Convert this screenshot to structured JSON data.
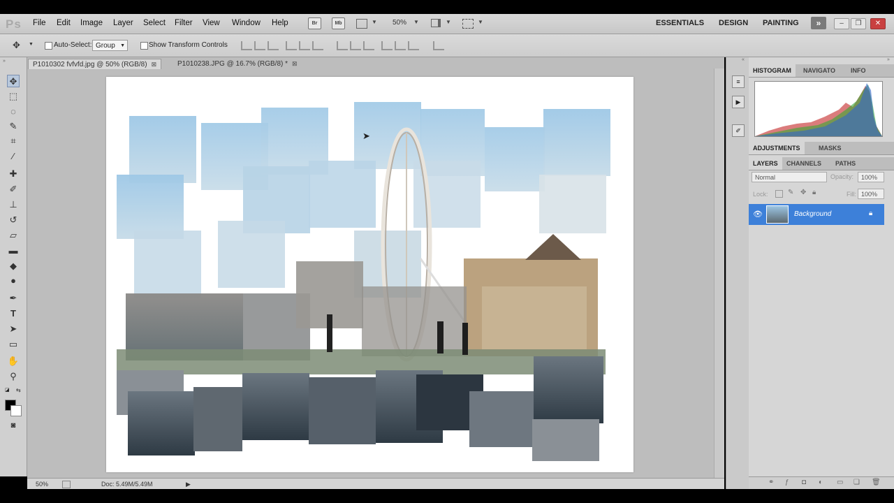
{
  "app": {
    "logo": "Ps"
  },
  "menu": [
    "File",
    "Edit",
    "Image",
    "Layer",
    "Select",
    "Filter",
    "View",
    "Window",
    "Help"
  ],
  "toolbar_icons": {
    "bridge": "Br",
    "minibridge": "Mb"
  },
  "zoom_top": "50%",
  "workspaces": [
    "ESSENTIALS",
    "DESIGN",
    "PAINTING"
  ],
  "workspace_more": "»",
  "window_controls": {
    "minimize": "–",
    "restore": "❐",
    "close": "✕"
  },
  "options": {
    "auto_select_label": "Auto-Select:",
    "auto_select_value": "Group",
    "show_transform_label": "Show Transform Controls"
  },
  "tabs": [
    {
      "label": "P1010302 fvfvfd.jpg @ 50% (RGB/8)",
      "close": "⊠"
    },
    {
      "label": "P1010238.JPG @ 16.7% (RGB/8) *",
      "close": "⊠"
    }
  ],
  "status": {
    "zoom": "50%",
    "doc": "Doc: 5.49M/5.49M",
    "arrow": "▶"
  },
  "panels": {
    "top_tabs": [
      "HISTOGRAM",
      "NAVIGATO",
      "INFO"
    ],
    "adj_tabs": [
      "ADJUSTMENTS",
      "MASKS"
    ],
    "layer_tabs": [
      "LAYERS",
      "CHANNELS",
      "PATHS"
    ],
    "blend_mode": "Normal",
    "opacity_label": "Opacity:",
    "opacity_value": "100%",
    "lock_label": "Lock:",
    "fill_label": "Fill:",
    "fill_value": "100%",
    "layer_name": "Background"
  },
  "colors": {
    "layer_selected": "#3d80d9",
    "canvas_bg": "#bdbdbd",
    "chrome": "#d4d4d4"
  }
}
